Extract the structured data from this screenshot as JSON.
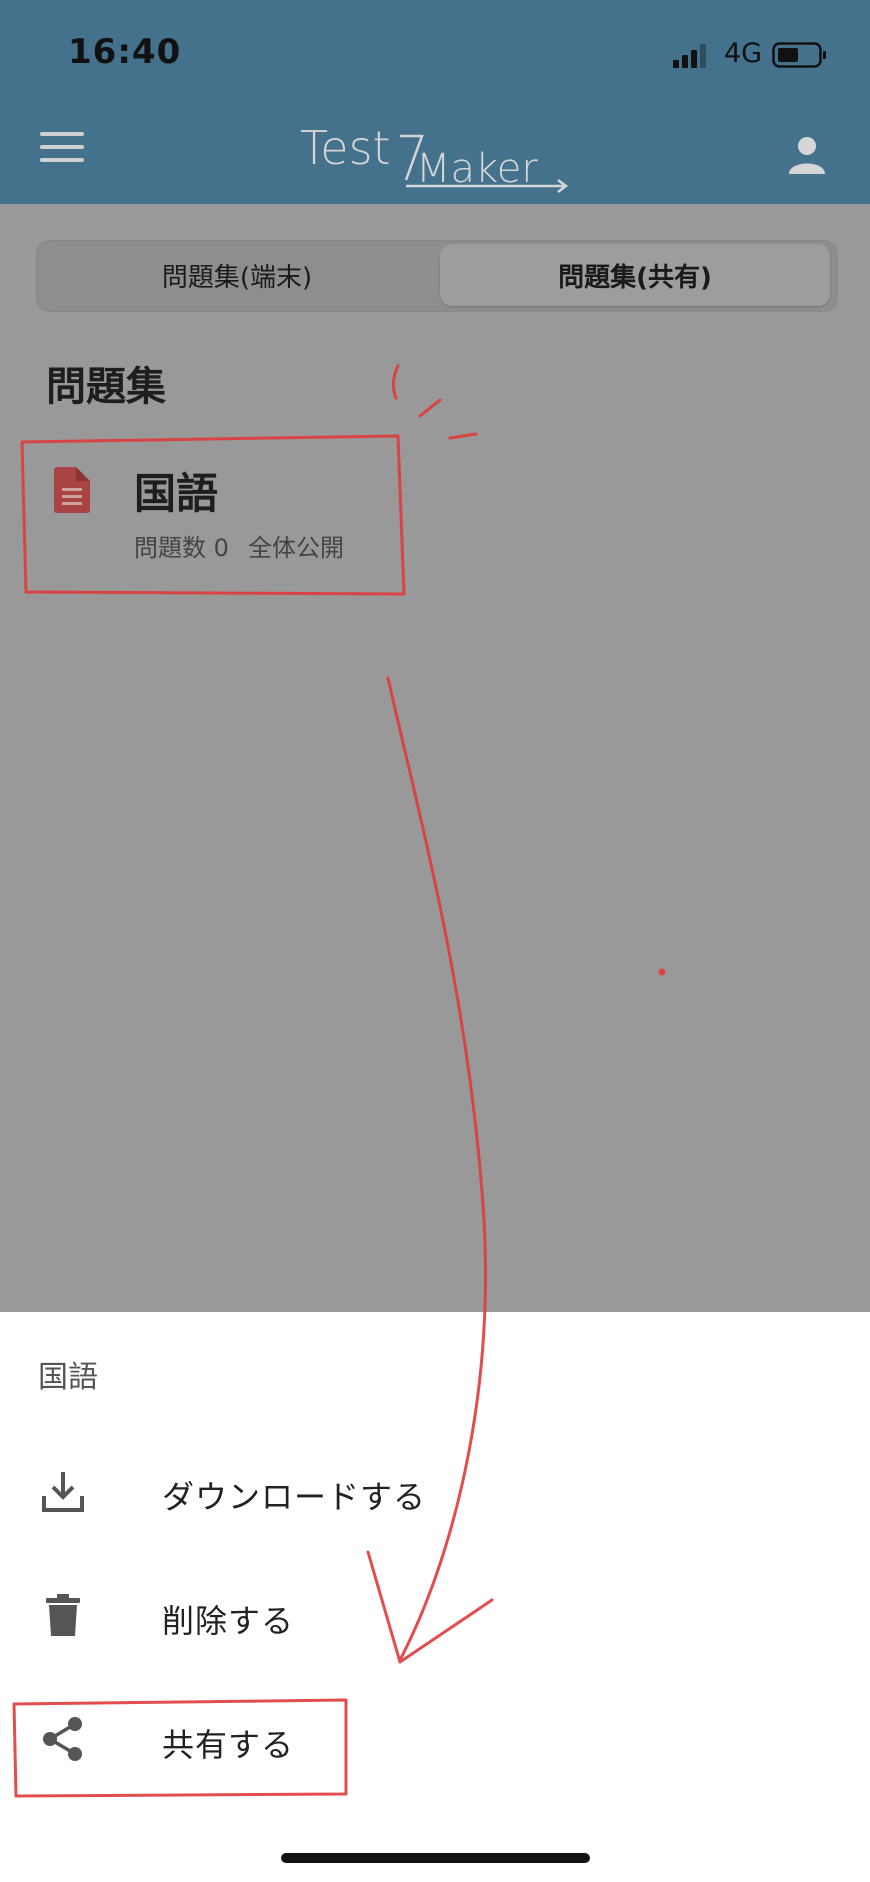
{
  "status_bar": {
    "time": "16:40",
    "network": "4G"
  },
  "app_bar": {
    "logo": "TestMaker"
  },
  "tabs": [
    {
      "label": "問題集(端末)",
      "selected": false
    },
    {
      "label": "問題集(共有)",
      "selected": true
    }
  ],
  "section": {
    "title": "問題集"
  },
  "workbook": {
    "title": "国語",
    "question_count": "問題数 0",
    "visibility": "全体公開"
  },
  "sheet": {
    "title": "国語",
    "actions": [
      {
        "label": "ダウンロードする",
        "icon": "download-icon"
      },
      {
        "label": "削除する",
        "icon": "trash-icon"
      },
      {
        "label": "共有する",
        "icon": "share-icon"
      }
    ]
  },
  "colors": {
    "app_bar": "#44718b",
    "overlay": "#999999",
    "annotation": "#e03a3a",
    "doc_icon": "#a94444"
  }
}
